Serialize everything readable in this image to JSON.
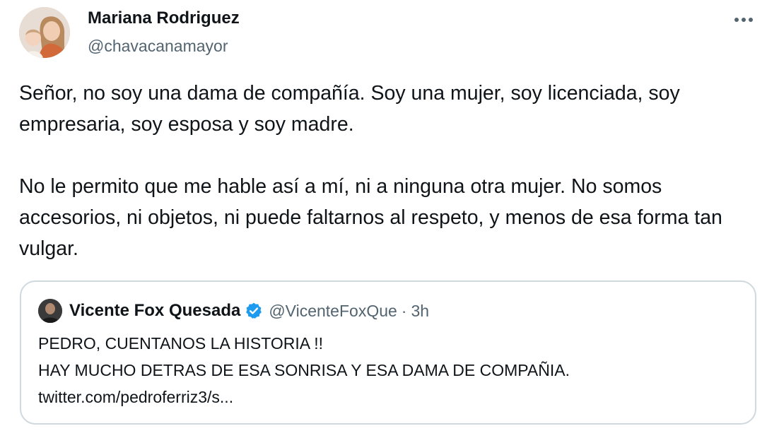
{
  "author": {
    "name": "Mariana Rodriguez",
    "handle": "@chavacanamayor"
  },
  "icons": {
    "more": "more-horizontal-icon",
    "verified": "verified-badge-icon"
  },
  "colors": {
    "verified_blue": "#1d9bf0",
    "secondary_text": "#536471",
    "card_border": "#cfd9de"
  },
  "tweet": {
    "paragraph_1": "Señor, no soy una dama de compañía. Soy una mujer, soy licenciada, soy empresaria, soy esposa y soy madre.",
    "paragraph_2": "No le permito que me hable así a mí, ni a ninguna otra mujer. No somos accesorios, ni objetos, ni puede faltarnos al respeto, y menos de esa forma tan vulgar."
  },
  "quoted_tweet": {
    "name": "Vicente Fox Quesada",
    "handle": "@VicenteFoxQue",
    "separator": "·",
    "time": "3h",
    "line_1": "PEDRO, CUENTANOS LA HISTORIA !!",
    "line_2": "HAY MUCHO DETRAS DE ESA SONRISA Y ESA DAMA DE COMPAÑIA.",
    "link": "twitter.com/pedroferriz3/s..."
  }
}
